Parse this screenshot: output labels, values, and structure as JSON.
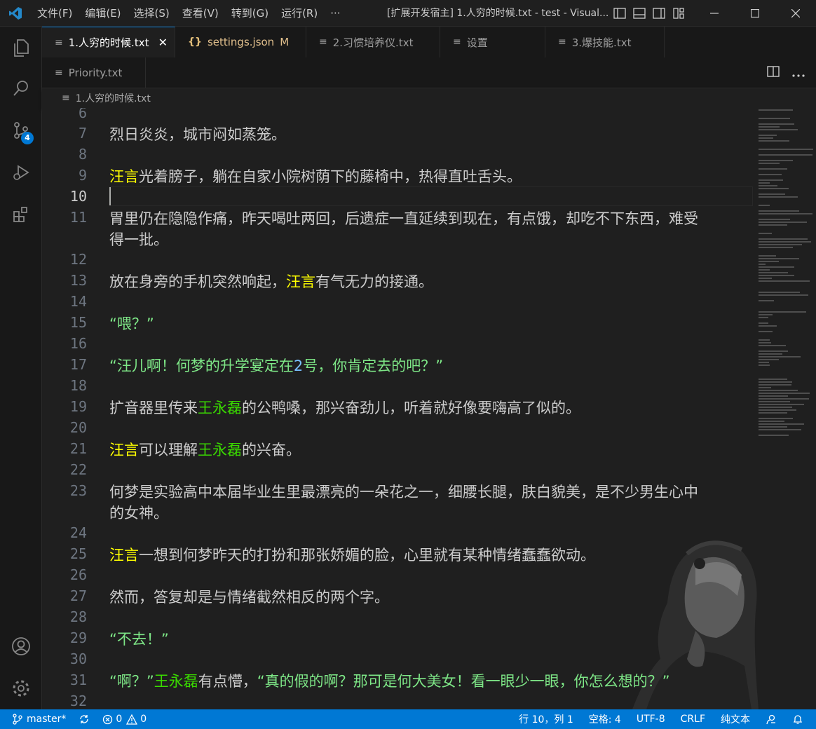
{
  "window": {
    "title": "[扩展开发宿主] 1.人穷的时候.txt - test - Visual...",
    "menu": [
      "文件(F)",
      "编辑(E)",
      "选择(S)",
      "查看(V)",
      "转到(G)",
      "运行(R)",
      "···"
    ]
  },
  "activity_bar": {
    "source_control_badge": "4"
  },
  "tabs_row1": [
    {
      "label": "1.人穷的时候.txt",
      "icon": "file-lines-icon",
      "active": true
    },
    {
      "label": "settings.json",
      "icon": "json-braces-icon",
      "modified": "M"
    },
    {
      "label": "2.习惯培养仪.txt",
      "icon": "file-lines-icon"
    },
    {
      "label": "设置",
      "icon": "file-lines-icon"
    },
    {
      "label": "3.爆技能.txt",
      "icon": "file-lines-icon"
    }
  ],
  "tabs_row2": [
    {
      "label": "Priority.txt",
      "icon": "file-lines-icon"
    }
  ],
  "breadcrumb": "1.人穷的时候.txt",
  "editor": {
    "current_line": 10,
    "lines": {
      "l6": "6",
      "l7": "7",
      "t7": "烈日炎炎，城市闷如蒸笼。",
      "l8": "8",
      "l9": "9",
      "t9a": "汪言",
      "t9b": "光着膀子，躺在自家小院树荫下的藤椅中，热得直吐舌头。",
      "l10": "10",
      "l11": "11",
      "t11a": "胃里仍在隐隐作痛，昨天喝吐两回，后遗症一直延续到现在，有点饿，却吃不下东西，难受",
      "t11b": "得一批。",
      "l12": "12",
      "l13": "13",
      "t13a": "放在身旁的手机突然响起，",
      "t13b": "汪言",
      "t13c": "有气无力的接通。",
      "l14": "14",
      "l15": "15",
      "t15": "“喂？”",
      "l16": "16",
      "l17": "17",
      "t17a": "“汪儿啊！何梦的升学宴定在",
      "t17b": "2",
      "t17c": "号，你肯定去的吧？”",
      "l18": "18",
      "l19": "19",
      "t19a": "扩音器里传来",
      "t19b": "王永磊",
      "t19c": "的公鸭嗓，那兴奋劲儿，听着就好像要嗨高了似的。",
      "l20": "20",
      "l21": "21",
      "t21a": "汪言",
      "t21b": "可以理解",
      "t21c": "王永磊",
      "t21d": "的兴奋。",
      "l22": "22",
      "l23": "23",
      "t23a": "何梦是实验高中本届毕业生里最漂亮的一朵花之一，细腰长腿，肤白貌美，是不少男生心中",
      "t23b": "的女神。",
      "l24": "24",
      "l25": "25",
      "t25a": "汪言",
      "t25b": "一想到何梦昨天的打扮和那张娇媚的脸，心里就有某种情绪蠢蠢欲动。",
      "l26": "26",
      "l27": "27",
      "t27": "然而，答复却是与情绪截然相反的两个字。",
      "l28": "28",
      "l29": "29",
      "t29": "“不去！”",
      "l30": "30",
      "l31": "31",
      "t31a": "“啊？”",
      "t31b": "王永磊",
      "t31c": "有点懵，",
      "t31d": "“真的假的啊？那可是何大美女！看一眼少一眼，你怎么想的？”",
      "l32": "32"
    }
  },
  "status_bar": {
    "branch": "master*",
    "errors": "0",
    "warnings": "0",
    "position": "行 10，列 1",
    "spaces": "空格: 4",
    "encoding": "UTF-8",
    "eol": "CRLF",
    "language": "纯文本"
  },
  "colors": {
    "accent": "#0078d4",
    "name_highlight_1": "#ffff00",
    "name_highlight_2": "#3ad900",
    "quote_green": "#7ee787"
  }
}
